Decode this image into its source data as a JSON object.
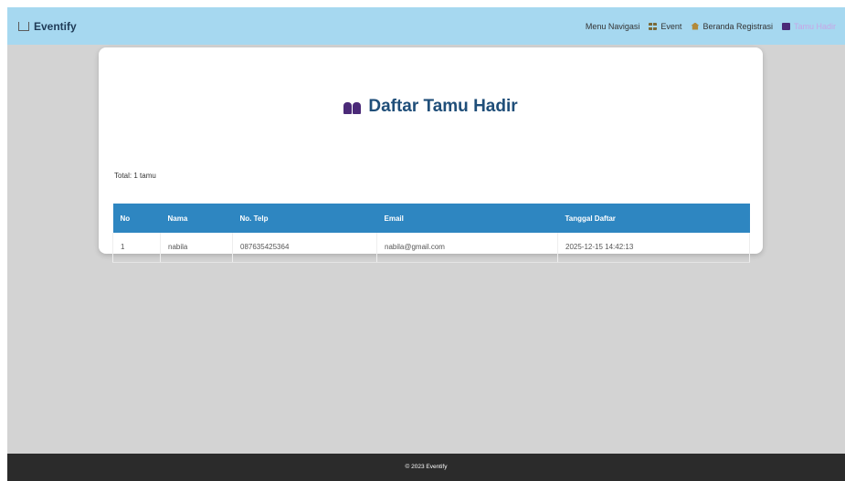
{
  "navbar": {
    "brand": "Eventify",
    "links": [
      {
        "label": "Menu Navigasi",
        "icon": "none"
      },
      {
        "label": "Event",
        "icon": "grid-icon"
      },
      {
        "label": "Beranda Registrasi",
        "icon": "home-icon"
      },
      {
        "label": "Tamu Hadir",
        "icon": "people-icon"
      }
    ]
  },
  "main": {
    "title": "Daftar Tamu Hadir",
    "total": "Total: 1 tamu",
    "table": {
      "headers": [
        "No",
        "Nama",
        "No. Telp",
        "Email",
        "Tanggal Daftar"
      ],
      "rows": [
        [
          "1",
          "nabila",
          "087635425364",
          "nabila@gmail.com",
          "2025-12-15 14:42:13"
        ]
      ]
    }
  },
  "footer": {
    "text": "© 2023 Eventify"
  },
  "colors": {
    "navbar_bg": "#a6d8f0",
    "table_header_bg": "#2e86c1",
    "title_color": "#1f4e79",
    "footer_bg": "#2b2b2b",
    "page_bg": "#d3d3d3"
  }
}
